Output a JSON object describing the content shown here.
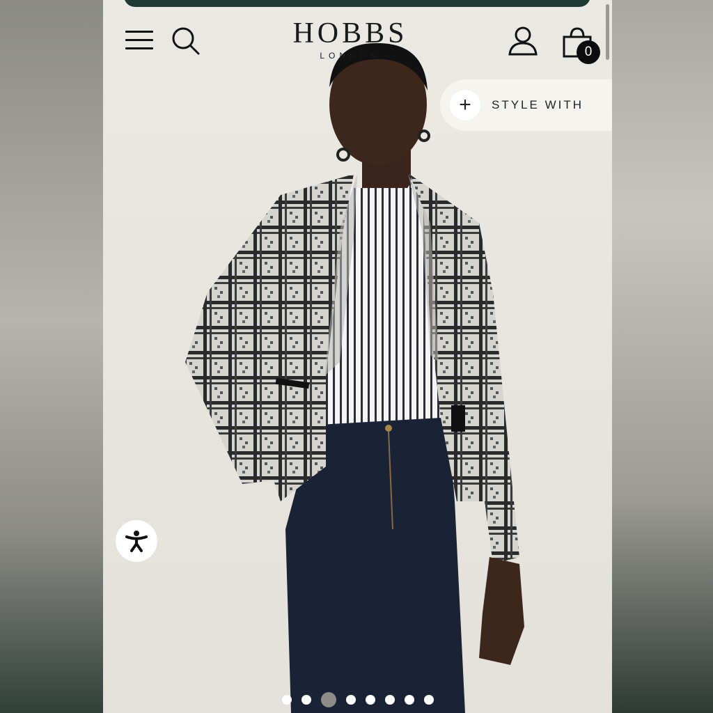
{
  "header": {
    "brand": "HOBBS",
    "brand_sub": "LONDON",
    "bag_count": "0"
  },
  "style_with": {
    "plus": "+",
    "label": "STYLE WITH"
  },
  "icons": {
    "menu": "hamburger-menu-icon",
    "search": "search-icon",
    "account": "user-icon",
    "bag": "shopping-bag-icon",
    "accessibility": "accessibility-icon"
  },
  "carousel": {
    "total": 8,
    "active_index": 2
  },
  "colors": {
    "background": "#e8e6df",
    "text": "#111111",
    "badge": "#0c0c0c",
    "top_bar": "#1f3a33"
  }
}
